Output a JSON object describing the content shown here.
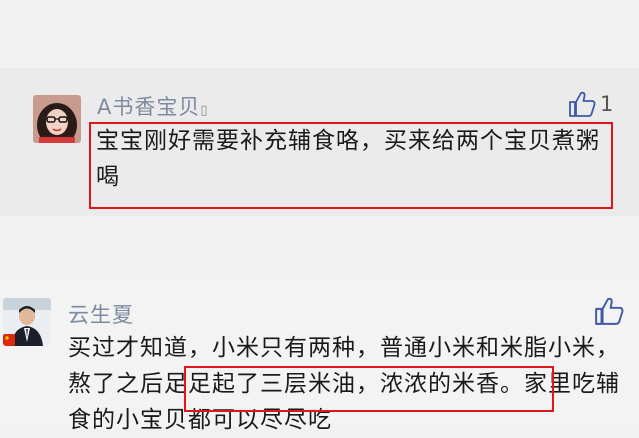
{
  "comments": [
    {
      "author": "A书香宝贝",
      "author_suffix": "▯",
      "likes": "1",
      "text": "宝宝刚好需要补充辅食咯，买来给两个宝贝煮粥喝"
    },
    {
      "author": "云生夏",
      "likes": "",
      "text_before": "买过才知道，小米只有两种，普通小米和米脂小米，",
      "text_highlight": "熬了之后足足起了三层米油，",
      "text_after": "浓浓的米香。家里吃辅食的小宝贝都可以尽尽吃"
    }
  ],
  "icons": {
    "like": "thumbs-up-icon",
    "flag": "china-flag-icon"
  },
  "colors": {
    "highlight": "#e0151d",
    "author_name": "#7e8aa0"
  }
}
